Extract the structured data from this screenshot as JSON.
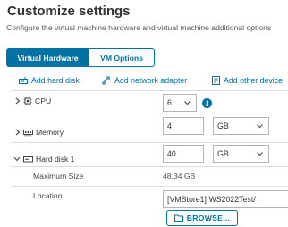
{
  "header": {
    "title": "Customize settings",
    "subtitle": "Configure the virtual machine hardware and virtual machine additional options"
  },
  "tabs": [
    {
      "label": "Virtual Hardware",
      "active": true
    },
    {
      "label": "VM Options",
      "active": false
    }
  ],
  "actions": {
    "add_hard_disk": "Add hard disk",
    "add_network_adapter": "Add network adapter",
    "add_other_devices": "Add other device"
  },
  "hardware": {
    "cpu": {
      "label": "CPU",
      "value": "6"
    },
    "memory": {
      "label": "Memory",
      "value": "4",
      "unit": "GB"
    },
    "hard_disk": {
      "label": "Hard disk 1",
      "value": "40",
      "unit": "GB",
      "maximum_size_label": "Maximum Size",
      "maximum_size_value": "48.34 GB",
      "location_label": "Location",
      "location_value": "[VMStore1] WS2022Test/",
      "browse_label": "BROWSE..."
    }
  },
  "colors": {
    "accent": "#0072a3",
    "text": "#333333",
    "border": "#b3b3b3"
  }
}
